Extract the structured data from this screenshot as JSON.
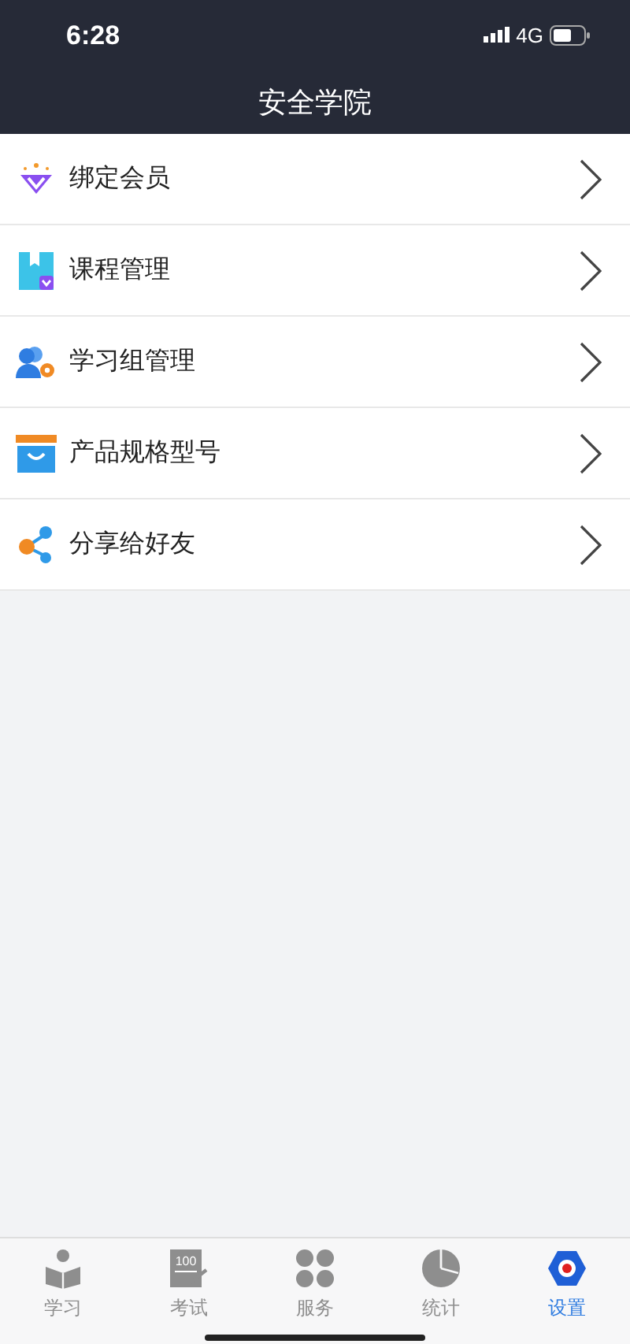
{
  "status_bar": {
    "time": "6:28",
    "network": "4G"
  },
  "header": {
    "title": "安全学院"
  },
  "menu": [
    {
      "kind": "member",
      "label": "绑定会员"
    },
    {
      "kind": "course",
      "label": "课程管理"
    },
    {
      "kind": "group",
      "label": "学习组管理"
    },
    {
      "kind": "product",
      "label": "产品规格型号"
    },
    {
      "kind": "share",
      "label": "分享给好友"
    }
  ],
  "tabs": [
    {
      "kind": "study",
      "label": "学习",
      "selected": false
    },
    {
      "kind": "exam",
      "label": "考试",
      "selected": false,
      "icon_text": "100"
    },
    {
      "kind": "service",
      "label": "服务",
      "selected": false
    },
    {
      "kind": "stats",
      "label": "统计",
      "selected": false
    },
    {
      "kind": "settings",
      "label": "设置",
      "selected": true
    }
  ]
}
